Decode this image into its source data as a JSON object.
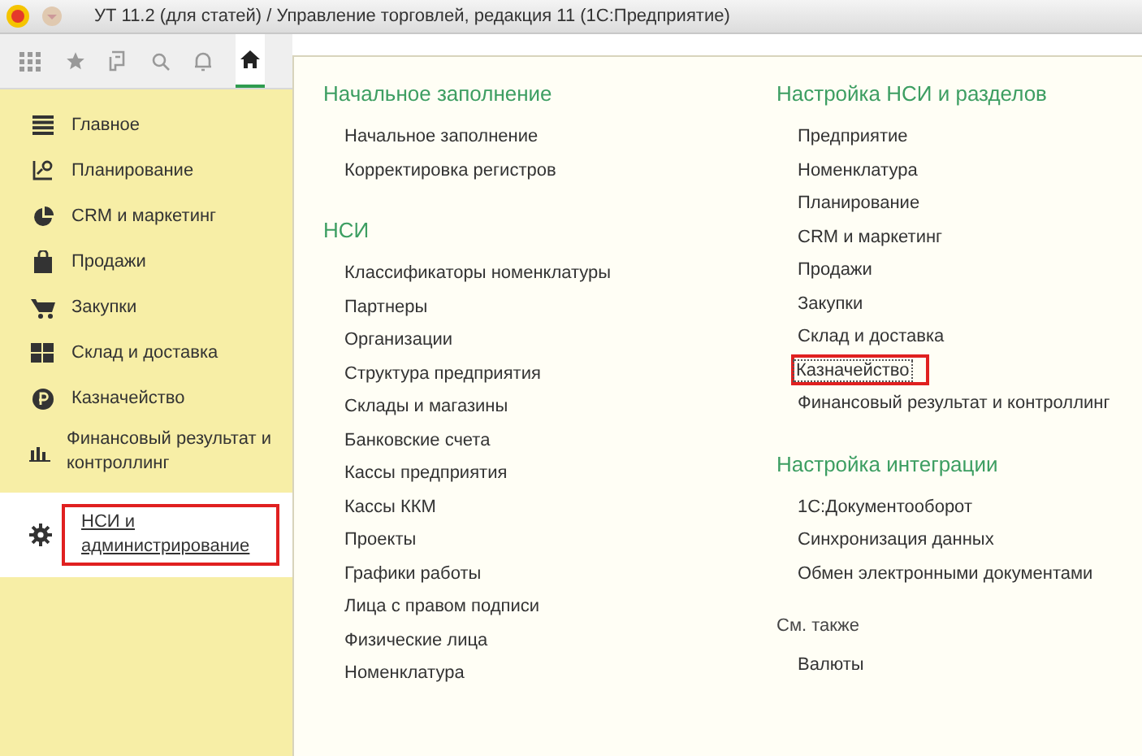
{
  "window": {
    "title": "УТ 11.2 (для статей) / Управление торговлей, редакция 11  (1С:Предприятие)"
  },
  "sidebar": {
    "items": [
      {
        "kind": "lines",
        "label": "Главное",
        "selected": false,
        "highlighted": false
      },
      {
        "kind": "plan",
        "label": "Планирование",
        "selected": false,
        "highlighted": false
      },
      {
        "kind": "pie",
        "label": "CRM и маркетинг",
        "selected": false,
        "highlighted": false
      },
      {
        "kind": "bag",
        "label": "Продажи",
        "selected": false,
        "highlighted": false
      },
      {
        "kind": "cart",
        "label": "Закупки",
        "selected": false,
        "highlighted": false
      },
      {
        "kind": "grid",
        "label": "Склад и доставка",
        "selected": false,
        "highlighted": false
      },
      {
        "kind": "coin",
        "label": "Казначейство",
        "selected": false,
        "highlighted": false
      },
      {
        "kind": "bars",
        "label": "Финансовый результат и контроллинг",
        "selected": false,
        "highlighted": false
      },
      {
        "kind": "gear",
        "label": "НСИ и администрирование",
        "selected": true,
        "highlighted": true
      }
    ]
  },
  "columns": [
    {
      "sections": [
        {
          "kind": "group",
          "title": "Начальное заполнение",
          "items": [
            {
              "label": "Начальное заполнение",
              "highlighted": false,
              "focused": false
            },
            {
              "label": "Корректировка регистров",
              "highlighted": false,
              "focused": false
            }
          ]
        },
        {
          "kind": "group",
          "title": "НСИ",
          "items": [
            {
              "label": "Классификаторы номенклатуры",
              "highlighted": false,
              "focused": false
            },
            {
              "label": "Партнеры",
              "highlighted": false,
              "focused": false
            },
            {
              "label": "Организации",
              "highlighted": false,
              "focused": false
            },
            {
              "label": "Структура предприятия",
              "highlighted": false,
              "focused": false
            },
            {
              "label": "Склады и магазины",
              "highlighted": false,
              "focused": false
            },
            {
              "label": "Банковские счета",
              "highlighted": false,
              "focused": false
            },
            {
              "label": "Кассы предприятия",
              "highlighted": false,
              "focused": false
            },
            {
              "label": "Кассы ККМ",
              "highlighted": false,
              "focused": false
            },
            {
              "label": "Проекты",
              "highlighted": false,
              "focused": false
            },
            {
              "label": "Графики работы",
              "highlighted": false,
              "focused": false
            },
            {
              "label": "Лица с правом подписи",
              "highlighted": false,
              "focused": false
            },
            {
              "label": "Физические лица",
              "highlighted": false,
              "focused": false
            },
            {
              "label": "Номенклатура",
              "highlighted": false,
              "focused": false
            }
          ]
        }
      ]
    },
    {
      "sections": [
        {
          "kind": "group",
          "title": "Настройка НСИ и разделов",
          "items": [
            {
              "label": "Предприятие",
              "highlighted": false,
              "focused": false
            },
            {
              "label": "Номенклатура",
              "highlighted": false,
              "focused": false
            },
            {
              "label": "Планирование",
              "highlighted": false,
              "focused": false
            },
            {
              "label": "CRM и маркетинг",
              "highlighted": false,
              "focused": false
            },
            {
              "label": "Продажи",
              "highlighted": false,
              "focused": false
            },
            {
              "label": "Закупки",
              "highlighted": false,
              "focused": false
            },
            {
              "label": "Склад и доставка",
              "highlighted": false,
              "focused": false
            },
            {
              "label": "Казначейство",
              "highlighted": true,
              "focused": true
            },
            {
              "label": "Финансовый результат и контроллинг",
              "highlighted": false,
              "focused": false
            }
          ]
        },
        {
          "kind": "group",
          "title": "Настройка интеграции",
          "items": [
            {
              "label": "1С:Документооборот",
              "highlighted": false,
              "focused": false
            },
            {
              "label": "Синхронизация данных",
              "highlighted": false,
              "focused": false
            },
            {
              "label": "Обмен электронными документами",
              "highlighted": false,
              "focused": false
            }
          ]
        },
        {
          "kind": "see_also",
          "title": "См. также",
          "items": [
            {
              "label": "Валюты",
              "highlighted": false,
              "focused": false
            }
          ]
        }
      ]
    }
  ]
}
